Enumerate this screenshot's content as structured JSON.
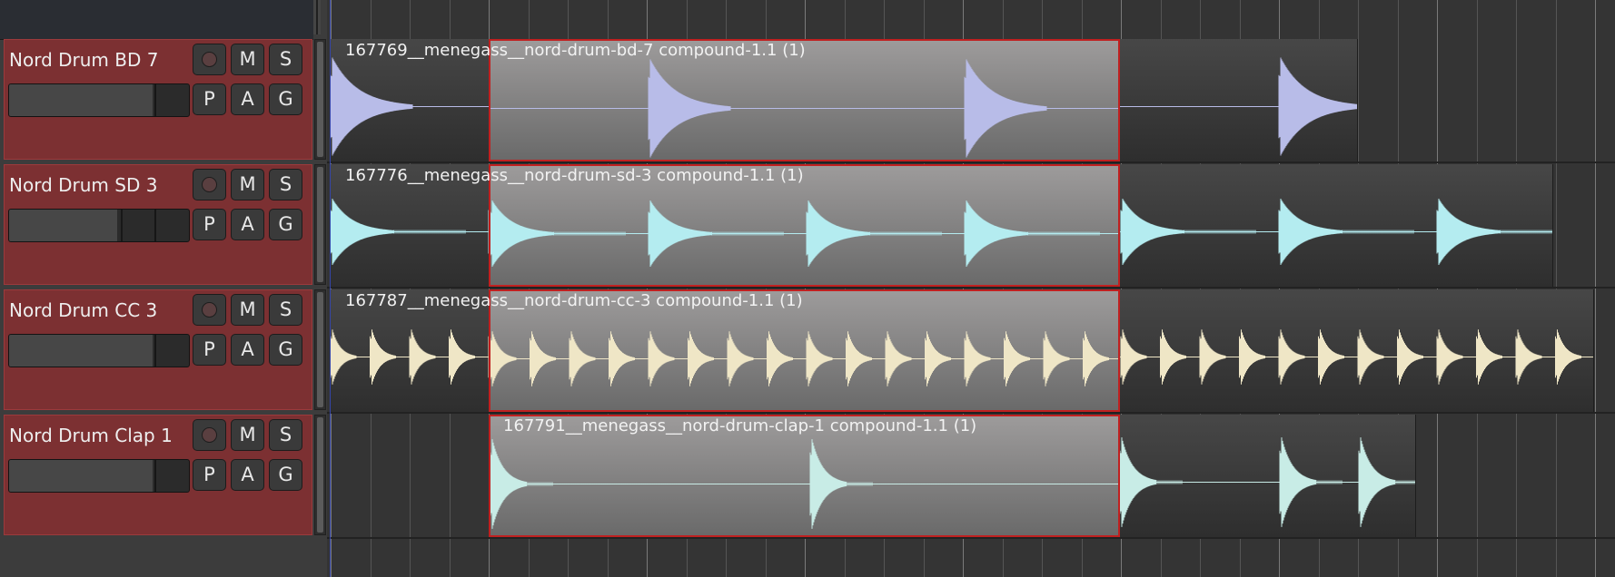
{
  "colors": {
    "track_header_bg": "#7c3032",
    "selection_border": "#c02020",
    "playhead": "#3445a8",
    "waveform_bd": "#b8bce8",
    "waveform_sd": "#b4ecf0",
    "waveform_cc": "#efe6c6",
    "waveform_clap": "#c8ece6"
  },
  "tracks": [
    {
      "name": "Nord Drum BD 7",
      "buttons": {
        "mute": "M",
        "solo": "S",
        "playlist": "P",
        "automation": "A",
        "group": "G"
      },
      "record_icon": "record-enable-icon",
      "fader_level": 0.8,
      "region_name": "167769__menegass__nord-drum-bd-7 compound-1.1 (1)"
    },
    {
      "name": "Nord Drum SD 3",
      "buttons": {
        "mute": "M",
        "solo": "S",
        "playlist": "P",
        "automation": "A",
        "group": "G"
      },
      "record_icon": "record-enable-icon",
      "fader_level": 0.6,
      "region_name": "167776__menegass__nord-drum-sd-3 compound-1.1 (1)"
    },
    {
      "name": "Nord Drum CC 3",
      "buttons": {
        "mute": "M",
        "solo": "S",
        "playlist": "P",
        "automation": "A",
        "group": "G"
      },
      "record_icon": "record-enable-icon",
      "fader_level": 0.8,
      "region_name": "167787__menegass__nord-drum-cc-3 compound-1.1 (1)"
    },
    {
      "name": "Nord Drum Clap 1",
      "buttons": {
        "mute": "M",
        "solo": "S",
        "playlist": "P",
        "automation": "A",
        "group": "G"
      },
      "record_icon": "record-enable-icon",
      "fader_level": 0.8,
      "region_name": "167791__menegass__nord-drum-clap-1 compound-1.1 (1)"
    }
  ]
}
